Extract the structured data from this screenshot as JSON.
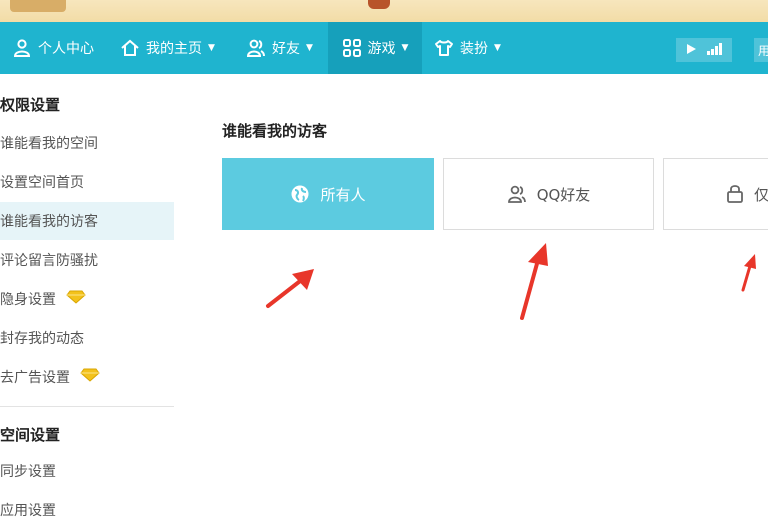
{
  "nav": {
    "items": [
      {
        "label": "个人中心",
        "icon": "user-icon"
      },
      {
        "label": "我的主页",
        "icon": "home-icon"
      },
      {
        "label": "好友",
        "icon": "friends-icon"
      },
      {
        "label": "游戏",
        "icon": "grid-icon"
      },
      {
        "label": "装扮",
        "icon": "shirt-icon"
      }
    ],
    "right_partial": "用"
  },
  "sidebar": {
    "sections": [
      {
        "title": "权限设置",
        "items": [
          {
            "label": "谁能看我的空间"
          },
          {
            "label": "设置空间首页"
          },
          {
            "label": "谁能看我的访客"
          },
          {
            "label": "评论留言防骚扰"
          },
          {
            "label": "隐身设置"
          },
          {
            "label": "封存我的动态"
          },
          {
            "label": "去广告设置"
          }
        ]
      },
      {
        "title": "空间设置",
        "items": [
          {
            "label": "同步设置"
          },
          {
            "label": "应用设置"
          }
        ]
      }
    ]
  },
  "main": {
    "title": "谁能看我的访客",
    "options": [
      {
        "label": "所有人",
        "icon": "globe-icon"
      },
      {
        "label": "QQ好友",
        "icon": "friends-icon"
      },
      {
        "label": "仅",
        "icon": "lock-icon"
      }
    ]
  },
  "colors": {
    "navbar": "#1fb4cf",
    "selected_option": "#5ccbe0",
    "arrow": "#e8362a",
    "gem": "#f3c21c"
  }
}
